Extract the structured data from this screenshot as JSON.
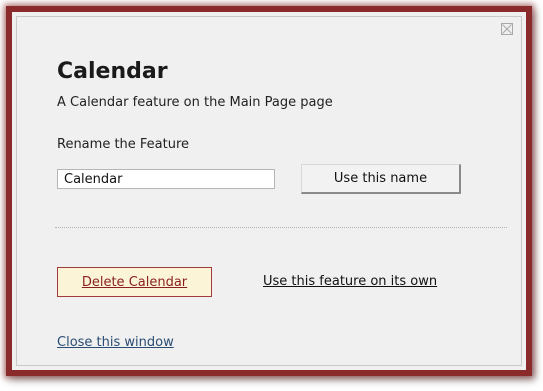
{
  "dialog": {
    "title": "Calendar",
    "subtitle": "A Calendar feature on the Main Page page",
    "rename_label": "Rename the Feature",
    "name_input_value": "Calendar",
    "use_name_label": "Use this name",
    "delete_label": "Delete Calendar",
    "own_link_label": "Use this feature on its own",
    "close_link_label": "Close this window",
    "close_icon": "close-x-icon"
  },
  "colors": {
    "frame_border": "#8a2a2a",
    "panel_bg": "#f0f0f0",
    "delete_bg": "#fbf4d6",
    "delete_border": "#a23b3b",
    "link_blue": "#2a4d73"
  }
}
